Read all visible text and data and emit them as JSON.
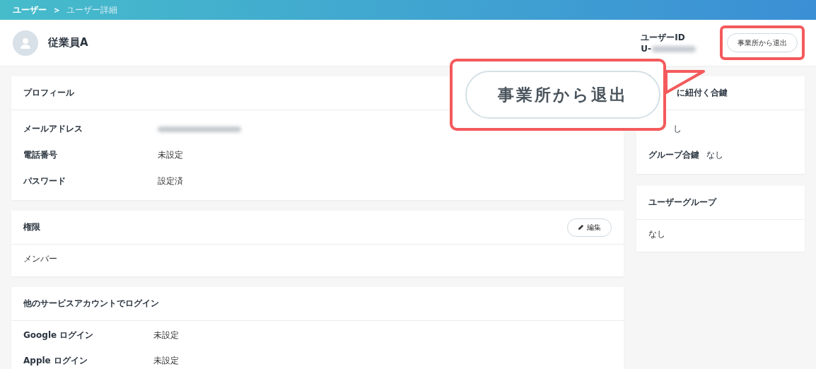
{
  "breadcrumb": [
    {
      "label": "ユーザー",
      "current": false
    },
    {
      "label": ">",
      "kind": "separator"
    },
    {
      "label": "ユーザー詳細",
      "current": true
    }
  ],
  "header": {
    "name": "従業員A",
    "user_id_label": "ユーザーID",
    "user_id_prefix": "U-",
    "leave_button": "事業所から退出"
  },
  "profile": {
    "title": "プロフィール",
    "rows": [
      {
        "label": "メールアドレス",
        "redacted": true
      },
      {
        "label": "電話番号",
        "value": "未設定",
        "redacted": false
      },
      {
        "label": "パスワード",
        "value": "設定済",
        "redacted": false
      }
    ]
  },
  "permission": {
    "title": "権限",
    "edit_button": "編集",
    "value": "メンバー"
  },
  "social_login": {
    "title": "他のサービスアカウントでログイン",
    "rows": [
      {
        "label": "Google ログイン",
        "value": "未設定"
      },
      {
        "label": "Apple ログイン",
        "value": "未設定"
      }
    ]
  },
  "keys": {
    "title": "に紐付く合鍵",
    "rows": [
      {
        "value": "し"
      },
      {
        "label": "グループ合鍵",
        "value": "なし"
      }
    ]
  },
  "user_groups": {
    "title": "ユーザーグループ",
    "value": "なし"
  },
  "callout": {
    "text": "事業所から退出"
  }
}
